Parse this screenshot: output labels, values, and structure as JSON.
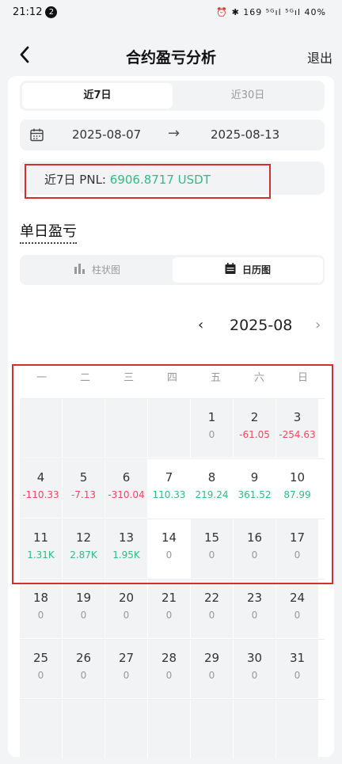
{
  "status": {
    "time": "21:12",
    "badge": "2",
    "right_text": "⏰ ✱ 169 ⁵ᴳıl ⁵ᴳıl 40%"
  },
  "header": {
    "title": "合约盈亏分析",
    "exit_label": "退出"
  },
  "range_tabs": [
    {
      "label": "近7日",
      "active": true
    },
    {
      "label": "近30日",
      "active": false
    }
  ],
  "date_range": {
    "start": "2025-08-07",
    "arrow": "→",
    "end": "2025-08-13"
  },
  "pnl": {
    "label": "近7日 PNL: ",
    "value": "6906.8717 USDT"
  },
  "section": {
    "title": "单日盈亏"
  },
  "chart_tabs": [
    {
      "label": "柱状图",
      "icon": "bar-chart-icon",
      "active": false
    },
    {
      "label": "日历图",
      "icon": "calendar-icon",
      "active": true
    }
  ],
  "month": {
    "prev": "‹",
    "label": "2025-08",
    "next": "›"
  },
  "calendar": {
    "weekdays": [
      "一",
      "二",
      "三",
      "四",
      "五",
      "六",
      "日"
    ],
    "weeks": [
      [
        {
          "d": "",
          "v": "",
          "t": "empty"
        },
        {
          "d": "",
          "v": "",
          "t": "empty"
        },
        {
          "d": "",
          "v": "",
          "t": "empty"
        },
        {
          "d": "",
          "v": "",
          "t": "empty"
        },
        {
          "d": "1",
          "v": "0",
          "t": "zero"
        },
        {
          "d": "2",
          "v": "-61.05",
          "t": "neg"
        },
        {
          "d": "3",
          "v": "-254.63",
          "t": "neg"
        }
      ],
      [
        {
          "d": "4",
          "v": "-110.33",
          "t": "neg"
        },
        {
          "d": "5",
          "v": "-7.13",
          "t": "neg"
        },
        {
          "d": "6",
          "v": "-310.04",
          "t": "neg"
        },
        {
          "d": "7",
          "v": "110.33",
          "t": "pos"
        },
        {
          "d": "8",
          "v": "219.24",
          "t": "pos"
        },
        {
          "d": "9",
          "v": "361.52",
          "t": "pos"
        },
        {
          "d": "10",
          "v": "87.99",
          "t": "pos"
        }
      ],
      [
        {
          "d": "11",
          "v": "1.31K",
          "t": "pos"
        },
        {
          "d": "12",
          "v": "2.87K",
          "t": "pos"
        },
        {
          "d": "13",
          "v": "1.95K",
          "t": "pos"
        },
        {
          "d": "14",
          "v": "0",
          "t": "zero"
        },
        {
          "d": "15",
          "v": "0",
          "t": "zero"
        },
        {
          "d": "16",
          "v": "0",
          "t": "zero"
        },
        {
          "d": "17",
          "v": "0",
          "t": "zero"
        }
      ],
      [
        {
          "d": "18",
          "v": "0",
          "t": "zero"
        },
        {
          "d": "19",
          "v": "0",
          "t": "zero"
        },
        {
          "d": "20",
          "v": "0",
          "t": "zero"
        },
        {
          "d": "21",
          "v": "0",
          "t": "zero"
        },
        {
          "d": "22",
          "v": "0",
          "t": "zero"
        },
        {
          "d": "23",
          "v": "0",
          "t": "zero"
        },
        {
          "d": "24",
          "v": "0",
          "t": "zero"
        }
      ],
      [
        {
          "d": "25",
          "v": "0",
          "t": "zero"
        },
        {
          "d": "26",
          "v": "0",
          "t": "zero"
        },
        {
          "d": "27",
          "v": "0",
          "t": "zero"
        },
        {
          "d": "28",
          "v": "0",
          "t": "zero"
        },
        {
          "d": "29",
          "v": "0",
          "t": "zero"
        },
        {
          "d": "30",
          "v": "0",
          "t": "zero"
        },
        {
          "d": "31",
          "v": "0",
          "t": "zero"
        }
      ],
      [
        {
          "d": "",
          "v": "",
          "t": "empty"
        },
        {
          "d": "",
          "v": "",
          "t": "empty"
        },
        {
          "d": "",
          "v": "",
          "t": "empty"
        },
        {
          "d": "",
          "v": "",
          "t": "empty"
        },
        {
          "d": "",
          "v": "",
          "t": "empty"
        },
        {
          "d": "",
          "v": "",
          "t": "empty"
        },
        {
          "d": "",
          "v": "",
          "t": "empty"
        }
      ]
    ]
  },
  "colors": {
    "positive": "#2ebd85",
    "negative": "#f6465d",
    "highlight_box": "#d32f2f"
  }
}
